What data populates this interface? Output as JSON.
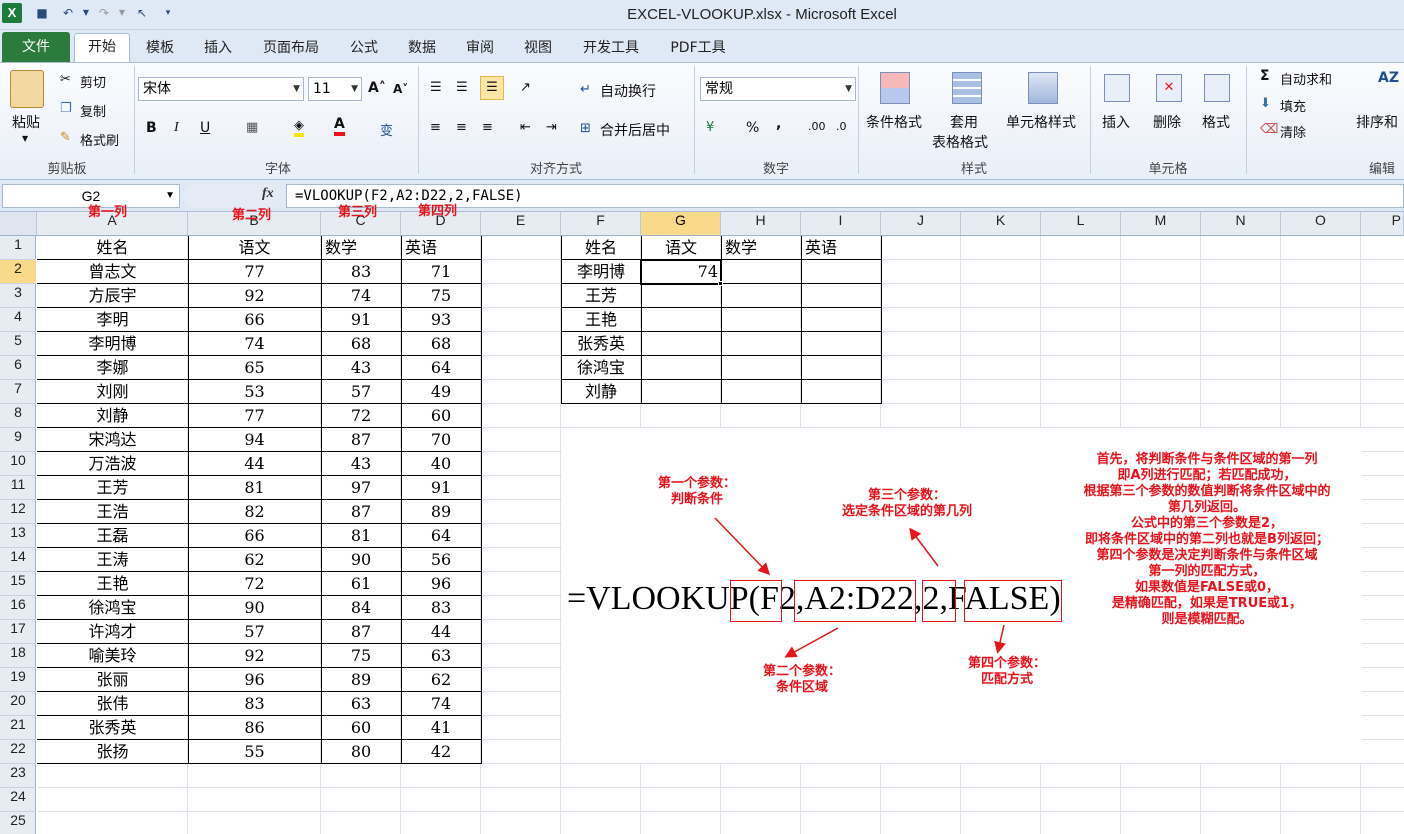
{
  "window": {
    "title": "EXCEL-VLOOKUP.xlsx - Microsoft Excel"
  },
  "tabs": {
    "file": "文件",
    "items": [
      "开始",
      "插入",
      "页面布局",
      "公式",
      "数据",
      "审阅",
      "视图",
      "开发工具",
      "PDF工具"
    ],
    "home": "开始",
    "insert_like": "模板"
  },
  "ribbon": {
    "clipboard": {
      "paste": "粘贴",
      "cut": "剪切",
      "copy": "复制",
      "painter": "格式刷",
      "label": "剪贴板"
    },
    "font": {
      "name": "宋体",
      "size": "11",
      "label": "字体",
      "bold": "B",
      "italic": "I",
      "underline": "U"
    },
    "alignment": {
      "wrap": "自动换行",
      "merge": "合并后居中",
      "label": "对齐方式"
    },
    "number": {
      "format": "常规",
      "label": "数字",
      "percent": "%",
      "comma": ","
    },
    "styles": {
      "conditional": "条件格式",
      "table_l1": "套用",
      "table_l2": "表格格式",
      "cell_styles": "单元格样式",
      "label": "样式"
    },
    "cells": {
      "insert": "插入",
      "delete": "删除",
      "format": "格式",
      "label": "单元格"
    },
    "editing": {
      "autosum": "自动求和",
      "fill": "填充",
      "clear": "清除",
      "sort": "排序和",
      "label": "编辑"
    }
  },
  "formula_bar": {
    "name_box": "G2",
    "fx": "fx",
    "formula": "=VLOOKUP(F2,A2:D22,2,FALSE)"
  },
  "columns": [
    "A",
    "B",
    "C",
    "D",
    "E",
    "F",
    "G",
    "H",
    "I",
    "J",
    "K",
    "L",
    "M",
    "N",
    "O",
    "P"
  ],
  "rows": [
    "1",
    "2",
    "3",
    "4",
    "5",
    "6",
    "7",
    "8",
    "9",
    "10",
    "11",
    "12",
    "13",
    "14",
    "15",
    "16",
    "17",
    "18",
    "19",
    "20",
    "21",
    "22",
    "23",
    "24",
    "25"
  ],
  "col_notes": {
    "a": "第一列",
    "b": "第二列",
    "c": "第三列",
    "d": "第四列"
  },
  "main_table": {
    "headers": [
      "姓名",
      "语文",
      "数学",
      "英语"
    ],
    "rows": [
      [
        "曾志文",
        "77",
        "83",
        "71"
      ],
      [
        "方辰宇",
        "92",
        "74",
        "75"
      ],
      [
        "李明",
        "66",
        "91",
        "93"
      ],
      [
        "李明博",
        "74",
        "68",
        "68"
      ],
      [
        "李娜",
        "65",
        "43",
        "64"
      ],
      [
        "刘刚",
        "53",
        "57",
        "49"
      ],
      [
        "刘静",
        "77",
        "72",
        "60"
      ],
      [
        "宋鸿达",
        "94",
        "87",
        "70"
      ],
      [
        "万浩波",
        "44",
        "43",
        "40"
      ],
      [
        "王芳",
        "81",
        "97",
        "91"
      ],
      [
        "王浩",
        "82",
        "87",
        "89"
      ],
      [
        "王磊",
        "66",
        "81",
        "64"
      ],
      [
        "王涛",
        "62",
        "90",
        "56"
      ],
      [
        "王艳",
        "72",
        "61",
        "96"
      ],
      [
        "徐鸿宝",
        "90",
        "84",
        "83"
      ],
      [
        "许鸿才",
        "57",
        "87",
        "44"
      ],
      [
        "喻美玲",
        "92",
        "75",
        "63"
      ],
      [
        "张丽",
        "96",
        "89",
        "62"
      ],
      [
        "张伟",
        "83",
        "63",
        "74"
      ],
      [
        "张秀英",
        "86",
        "60",
        "41"
      ],
      [
        "张扬",
        "55",
        "80",
        "42"
      ]
    ]
  },
  "lookup_table": {
    "headers": [
      "姓名",
      "语文",
      "数学",
      "英语"
    ],
    "names": [
      "李明博",
      "王芳",
      "王艳",
      "张秀英",
      "徐鸿宝",
      "刘静"
    ],
    "g2_value": "74"
  },
  "annotations": {
    "param1": "第一个参数：\n判断条件",
    "param2": "第二个参数：\n条件区域",
    "param3": "第三个参数：\n选定条件区域的第几列",
    "param4": "第四个参数：\n匹配方式",
    "explanation": "首先，将判断条件与条件区域的第一列\n即A列进行匹配；若匹配成功，\n根据第三个参数的数值判断将条件区域中的\n第几列返回。\n公式中的第三个参数是2，\n即将条件区域中的第二列也就是B列返回；\n第四个参数是决定判断条件与条件区域\n第一列的匹配方式，\n如果数值是FALSE或0，\n是精确匹配，如果是TRUE或1，\n则是模糊匹配。",
    "big_formula": {
      "prefix": "=VLOOKUP(",
      "p1": "F2,",
      "p2": "A2:D22,",
      "p3": "2,",
      "p4": "FALSE",
      "suffix": ")"
    }
  },
  "colors": {
    "accent_red": "#e8141b",
    "file_tab": "#2b7b3d",
    "selection": "#f9d98a"
  }
}
